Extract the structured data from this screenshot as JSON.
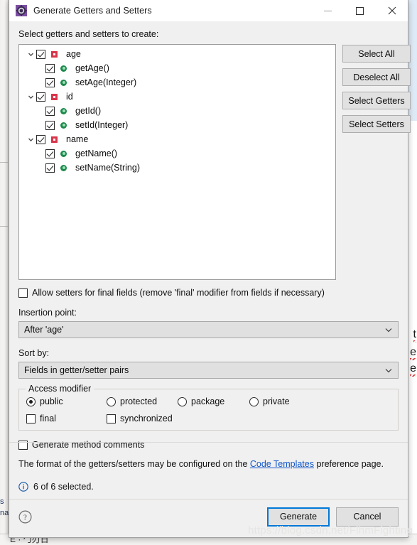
{
  "window": {
    "title": "Generate Getters and Setters",
    "icon": "eclipse-gear-icon",
    "minimize_label": "Minimize",
    "maximize_label": "Maximize",
    "close_label": "Close"
  },
  "tree_header_label": "Select getters and setters to create:",
  "tree": {
    "nodes": [
      {
        "label": "age",
        "type": "field",
        "checked": true,
        "expanded": true,
        "selected": true,
        "indent": 0
      },
      {
        "label": "getAge()",
        "type": "method",
        "checked": true,
        "expanded": false,
        "selected": false,
        "indent": 1
      },
      {
        "label": "setAge(Integer)",
        "type": "method",
        "checked": true,
        "expanded": false,
        "selected": false,
        "indent": 1
      },
      {
        "label": "id",
        "type": "field",
        "checked": true,
        "expanded": true,
        "selected": false,
        "indent": 0
      },
      {
        "label": "getId()",
        "type": "method",
        "checked": true,
        "expanded": false,
        "selected": false,
        "indent": 1
      },
      {
        "label": "setId(Integer)",
        "type": "method",
        "checked": true,
        "expanded": false,
        "selected": false,
        "indent": 1
      },
      {
        "label": "name",
        "type": "field",
        "checked": true,
        "expanded": true,
        "selected": false,
        "indent": 0
      },
      {
        "label": "getName()",
        "type": "method",
        "checked": true,
        "expanded": false,
        "selected": false,
        "indent": 1
      },
      {
        "label": "setName(String)",
        "type": "method",
        "checked": true,
        "expanded": false,
        "selected": false,
        "indent": 1
      }
    ]
  },
  "side_buttons": [
    {
      "label": "Select All"
    },
    {
      "label": "Deselect All"
    },
    {
      "label": "Select Getters"
    },
    {
      "label": "Select Setters"
    }
  ],
  "allow_final": {
    "label": "Allow setters for final fields (remove 'final' modifier from fields if necessary)",
    "checked": false
  },
  "insertion_point": {
    "label": "Insertion point:",
    "value": "After 'age'"
  },
  "sort_by": {
    "label": "Sort by:",
    "value": "Fields in getter/setter pairs"
  },
  "access_modifier": {
    "title": "Access modifier",
    "options": [
      {
        "label": "public",
        "selected": true
      },
      {
        "label": "protected",
        "selected": false
      },
      {
        "label": "package",
        "selected": false
      },
      {
        "label": "private",
        "selected": false
      }
    ],
    "modifiers": [
      {
        "label": "final",
        "checked": false
      },
      {
        "label": "synchronized",
        "checked": false
      }
    ]
  },
  "generate_comments": {
    "label": "Generate method comments",
    "checked": false
  },
  "format_note": {
    "prefix": "The format of the getters/setters may be configured on the ",
    "link": "Code Templates",
    "suffix": " preference page."
  },
  "status": {
    "icon": "info-icon",
    "text": "6 of 6 selected."
  },
  "footer": {
    "help_icon": "help-icon",
    "generate_label": "Generate",
    "cancel_label": "Cancel"
  },
  "watermark": "https://blog.csdn.net/FlhmFighting",
  "background": {
    "right_code_lines": [
      "t",
      "e",
      "e"
    ],
    "bottom_left_lines": [
      "s",
      "na"
    ],
    "bottom_bar_text": "E   · 勹刃日",
    "accent_blue": "#0078d7",
    "field_icon_color": "#d9354a",
    "method_icon_color": "#1c8b4a",
    "link_color": "#1155cc",
    "selection_color": "#cde8fb"
  }
}
